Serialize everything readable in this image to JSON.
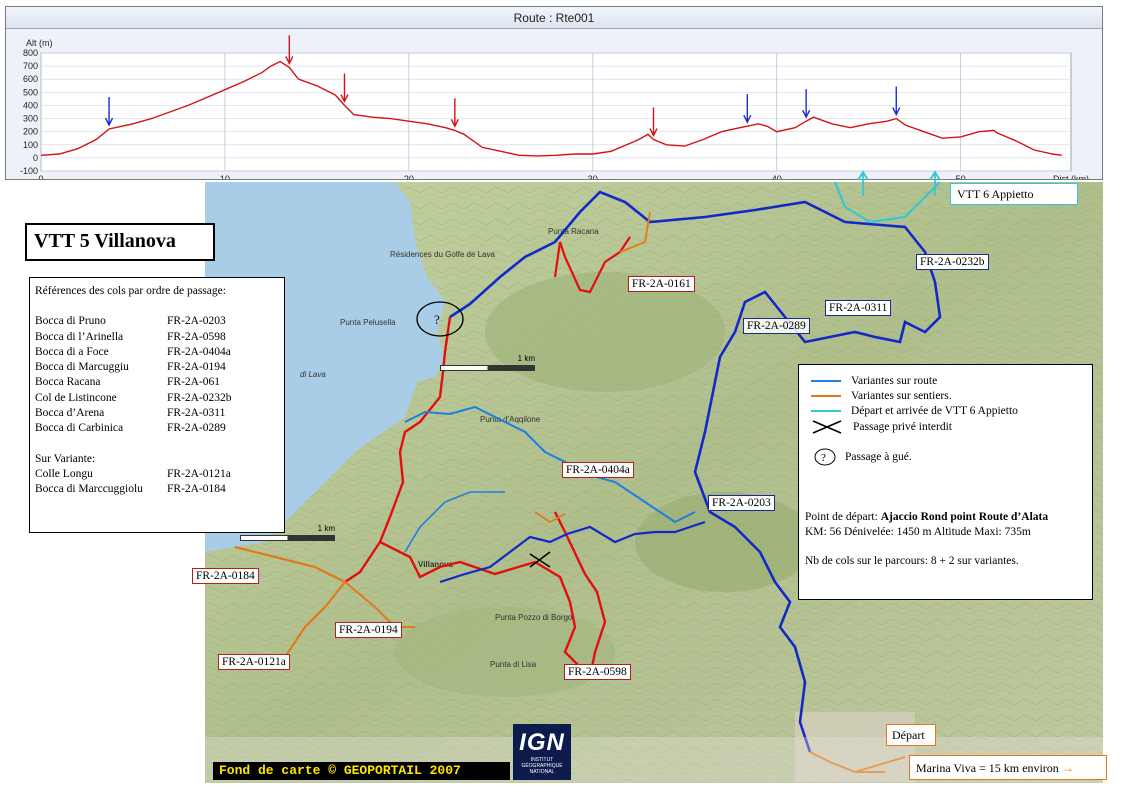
{
  "profile": {
    "title": "Route : Rte001",
    "y_axis_label": "Alt (m)",
    "x_axis_label": "Dist (km)",
    "y_ticks": [
      "800",
      "700",
      "600",
      "500",
      "400",
      "300",
      "200",
      "100",
      "0",
      "-100"
    ],
    "x_ticks": [
      "0",
      "10",
      "20",
      "30",
      "40",
      "50"
    ],
    "line_color": "#d21414",
    "chart_data": {
      "type": "line",
      "xlabel": "Dist (km)",
      "ylabel": "Alt (m)",
      "xlim": [
        0,
        56
      ],
      "ylim": [
        -100,
        800
      ],
      "x": [
        0,
        1,
        2,
        3,
        3.7,
        5,
        6,
        7,
        8,
        9,
        10,
        11,
        12,
        12.5,
        13,
        13.5,
        14,
        15,
        16,
        16.5,
        17,
        18,
        19,
        20,
        21,
        22,
        22.5,
        23,
        24,
        25,
        26,
        27,
        28,
        29,
        30,
        31,
        32,
        32.5,
        33,
        33.3,
        34,
        35,
        36,
        37,
        38,
        39,
        39.5,
        40,
        41,
        41.6,
        42,
        43,
        44,
        45,
        46,
        46.5,
        47,
        48,
        49,
        50,
        51,
        51.8,
        52,
        53,
        54,
        55,
        55.5
      ],
      "y": [
        20,
        30,
        70,
        140,
        220,
        260,
        300,
        350,
        400,
        460,
        520,
        580,
        650,
        700,
        735,
        690,
        600,
        550,
        480,
        400,
        330,
        310,
        300,
        280,
        260,
        230,
        210,
        180,
        80,
        50,
        20,
        15,
        20,
        30,
        30,
        50,
        110,
        140,
        180,
        140,
        100,
        90,
        140,
        200,
        230,
        260,
        240,
        200,
        230,
        280,
        310,
        260,
        230,
        260,
        280,
        300,
        250,
        200,
        150,
        160,
        200,
        210,
        190,
        130,
        60,
        30,
        20
      ],
      "markers": [
        {
          "x": 3.7,
          "color": "#1a2fd0"
        },
        {
          "x": 13.5,
          "color": "#d21414"
        },
        {
          "x": 16.5,
          "color": "#d21414"
        },
        {
          "x": 22.5,
          "color": "#d21414"
        },
        {
          "x": 33.3,
          "color": "#d21414"
        },
        {
          "x": 38.4,
          "color": "#1a2fd0"
        },
        {
          "x": 41.6,
          "color": "#1a2fd0"
        },
        {
          "x": 46.5,
          "color": "#1a2fd0"
        }
      ]
    }
  },
  "title": "VTT 5 Villanova",
  "refs": {
    "heading": "Références des cols par ordre de passage:",
    "main": [
      {
        "name": "Bocca di Pruno",
        "code": "FR-2A-0203"
      },
      {
        "name": "Bocca di l’Arinella",
        "code": "FR-2A-0598"
      },
      {
        "name": "Bocca di a Foce",
        "code": "FR-2A-0404a"
      },
      {
        "name": "Bocca di Marcuggiu",
        "code": "FR-2A-0194"
      },
      {
        "name": "Bocca Racana",
        "code": "FR-2A-061"
      },
      {
        "name": "Col de Listincone",
        "code": "FR-2A-0232b"
      },
      {
        "name": "Bocca d’Arena",
        "code": "FR-2A-0311"
      },
      {
        "name": "Bocca di Carbinica",
        "code": "FR-2A-0289"
      }
    ],
    "variant_heading": "Sur Variante:",
    "variants": [
      {
        "name": "Colle Longu",
        "code": "FR-2A-0121a"
      },
      {
        "name": "Bocca di Marccuggiolu",
        "code": "FR-2A-0184"
      }
    ]
  },
  "legend": {
    "items": [
      {
        "label": "Variantes sur route",
        "color": "#1f7fe0"
      },
      {
        "label": "Variantes sur sentiers.",
        "color": "#e07a1a"
      },
      {
        "label": "Départ et arrivée de VTT 6 Appietto",
        "color": "#37c7d4"
      },
      {
        "label": "Passage privé interdit",
        "color": "#000000"
      },
      {
        "label": "Passage à gué.",
        "symbol": "?"
      }
    ],
    "start_label": "Point de départ:",
    "start_value": "Ajaccio Rond point Route d’Alata",
    "stats": "KM: 56  Dénivelée: 1450 m   Altitude Maxi: 735m",
    "cols": "Nb de cols sur le parcours: 8 + 2 sur variantes."
  },
  "map_codes": {
    "c0161": "FR-2A-0161",
    "c0232b": "FR-2A-0232b",
    "c0311": "FR-2A-0311",
    "c0289": "FR-2A-0289",
    "c0404a": "FR-2A-0404a",
    "c0203": "FR-2A-0203",
    "c0184": "FR-2A-0184",
    "c0194": "FR-2A-0194",
    "c0121a": "FR-2A-0121a",
    "c0598": "FR-2A-0598"
  },
  "map_labels": {
    "golfe": "di Lava",
    "villanova": "Villanova",
    "residences": "Résidences du Golfe de Lava",
    "punta_pelusella": "Punta Pelusella",
    "pozzo": "Punta Pozzo di Borgo",
    "racana": "Punta Racana",
    "cuccia": "Punta di Lisa",
    "aqqillone": "Punta d'Aqqilone",
    "appietto_km": "1 km"
  },
  "vtt6": "VTT 6 Appietto",
  "depart": "Départ",
  "marina": "Marina Viva = 15 km environ",
  "ign": {
    "big": "IGN",
    "small": "INSTITUT GÉOGRAPHIQUE NATIONAL"
  },
  "copyright": "Fond de carte © GEOPORTAIL 2007",
  "scale1": "1 km",
  "scale2": "1 km",
  "colors": {
    "route_main_red": "#e01010",
    "route_main_blue": "#1428c8",
    "sea": "#a9cde6",
    "terrain": "#b8c79a"
  }
}
